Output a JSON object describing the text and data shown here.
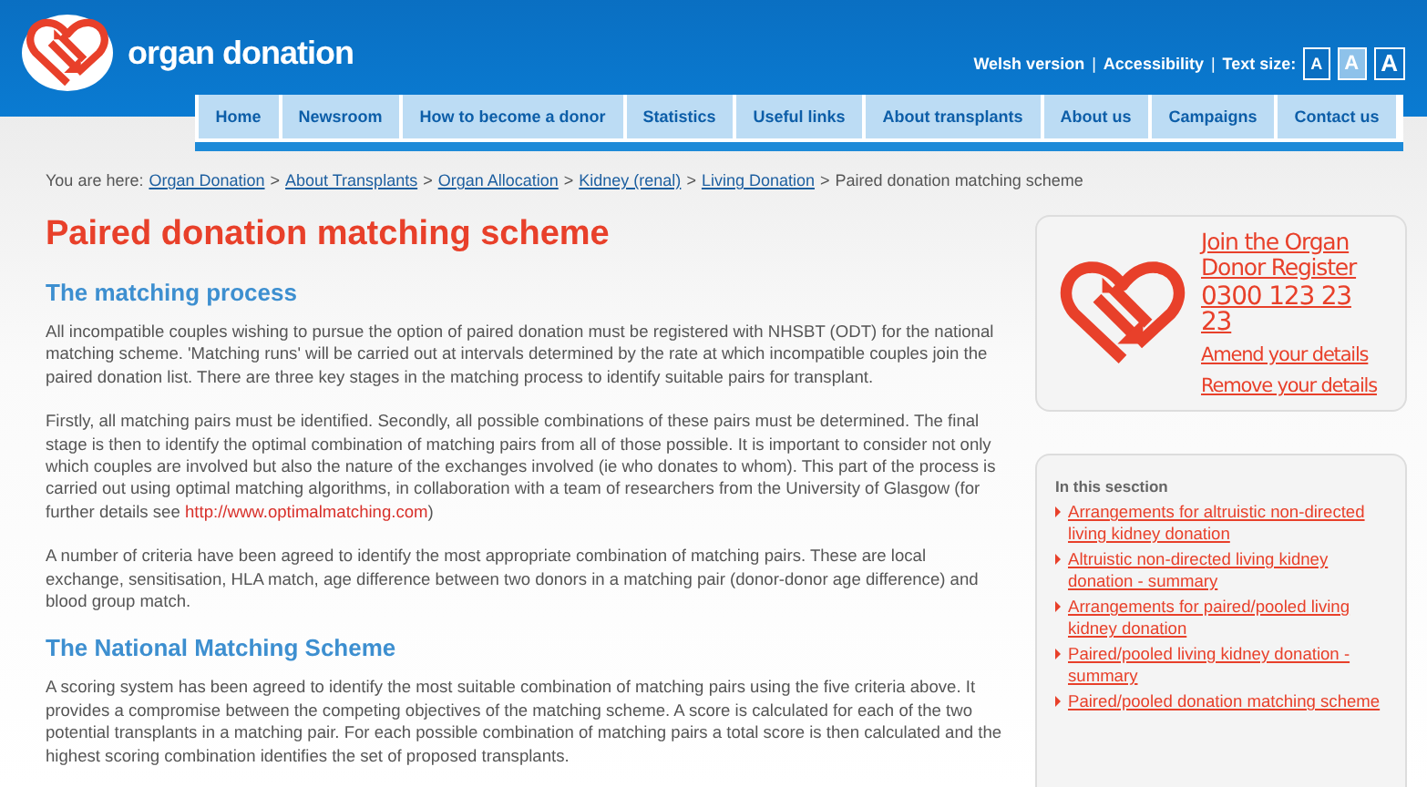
{
  "header": {
    "site_name": "organ donation",
    "top_links": [
      "Welsh version",
      "Accessibility"
    ],
    "separator": "|",
    "text_size_label": "Text size:",
    "text_sizes": [
      {
        "label": "A",
        "selected": false
      },
      {
        "label": "A",
        "selected": true
      },
      {
        "label": "A",
        "selected": false
      }
    ]
  },
  "nav": [
    "Home",
    "Newsroom",
    "How to become a donor",
    "Statistics",
    "Useful links",
    "About transplants",
    "About us",
    "Campaigns",
    "Contact us"
  ],
  "breadcrumb": {
    "label": "You are here:",
    "links": [
      "Organ Donation",
      "About Transplants",
      "Organ Allocation",
      "Kidney (renal)",
      "Living Donation"
    ],
    "separator": ">",
    "current": "Paired donation matching scheme"
  },
  "content": [
    {
      "kind": "title",
      "text": "Paired donation matching scheme"
    },
    {
      "kind": "heading",
      "text": "The matching process"
    },
    {
      "kind": "paragraph",
      "text": "All incompatible couples wishing to pursue the option of paired donation must be registered with NHSBT (ODT) for the national matching scheme. 'Matching runs' will be carried out at intervals determined by the rate at which incompatible couples join the paired donation list. There are three key stages in the matching process to identify suitable pairs for transplant."
    },
    {
      "kind": "paragraph",
      "text": "Firstly, all matching pairs must be identified. Secondly, all possible combinations of these pairs must be determined. The final stage is then to identify the optimal combination of matching pairs from all of those possible. It is important to consider not only which couples are involved but also the nature of the exchanges involved (ie who donates to whom). This part of the process is carried out using optimal matching algorithms, in collaboration with a team of researchers from the University of Glasgow (for further details see ",
      "link": "http://www.optimalmatching.com",
      "after": ")"
    },
    {
      "kind": "paragraph",
      "text": "A number of criteria have been agreed to identify the most appropriate combination of matching pairs. These are local exchange, sensitisation, HLA match, age difference between two donors in a matching pair (donor-donor age difference) and blood group match."
    },
    {
      "kind": "heading",
      "text": "The National Matching Scheme"
    },
    {
      "kind": "paragraph",
      "text": "A scoring system has been agreed to identify the most suitable combination of matching pairs using the five criteria above. It provides a compromise between the competing objectives of the matching scheme. A score is calculated for each of the two potential transplants in a matching pair. For each possible combination of matching pairs a total score is then calculated and the highest scoring combination identifies the set of proposed transplants."
    }
  ],
  "register_card": {
    "heading": "Join the Organ Donor Register",
    "phone": "0300 123 23 23",
    "links": [
      "Amend your details",
      "Remove your details"
    ]
  },
  "section_card": {
    "heading": "In this sesction",
    "links": [
      "Arrangements for altruistic non-directed living kidney donation",
      "Altruistic non-directed living kidney donation - summary",
      "Arrangements for paired/pooled living kidney donation",
      "Paired/pooled living kidney donation - summary",
      "Paired/pooled donation matching scheme"
    ]
  }
}
